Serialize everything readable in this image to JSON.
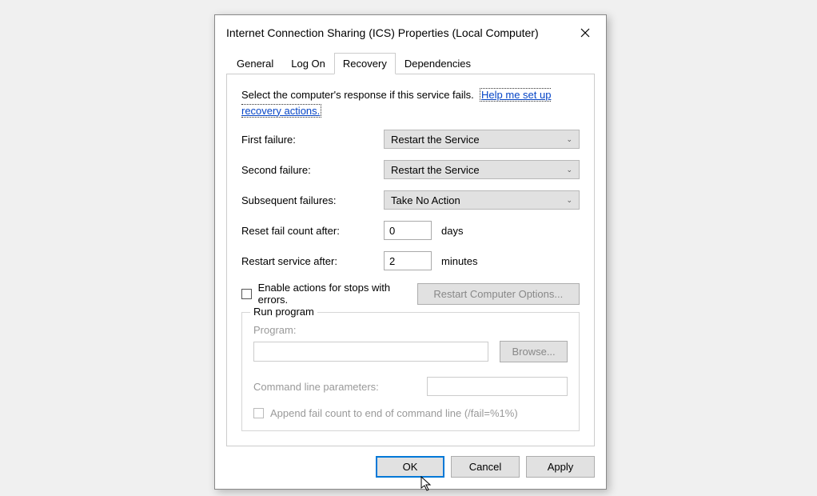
{
  "title": "Internet Connection Sharing (ICS) Properties (Local Computer)",
  "tabs": {
    "general": "General",
    "logon": "Log On",
    "recovery": "Recovery",
    "dependencies": "Dependencies"
  },
  "intro": {
    "text": "Select the computer's response if this service fails.",
    "help_link": "Help me set up recovery actions."
  },
  "rows": {
    "first_label": "First failure:",
    "first_value": "Restart the Service",
    "second_label": "Second failure:",
    "second_value": "Restart the Service",
    "subsequent_label": "Subsequent failures:",
    "subsequent_value": "Take No Action",
    "reset_label": "Reset fail count after:",
    "reset_value": "0",
    "reset_unit": "days",
    "restart_label": "Restart service after:",
    "restart_value": "2",
    "restart_unit": "minutes"
  },
  "enable_stops": "Enable actions for stops with errors.",
  "restart_options_btn": "Restart Computer Options...",
  "runprog": {
    "legend": "Run program",
    "program_label": "Program:",
    "program_value": "",
    "browse": "Browse...",
    "cmdline_label": "Command line parameters:",
    "cmdline_value": "",
    "append_label": "Append fail count to end of command line (/fail=%1%)"
  },
  "footer": {
    "ok": "OK",
    "cancel": "Cancel",
    "apply": "Apply"
  }
}
